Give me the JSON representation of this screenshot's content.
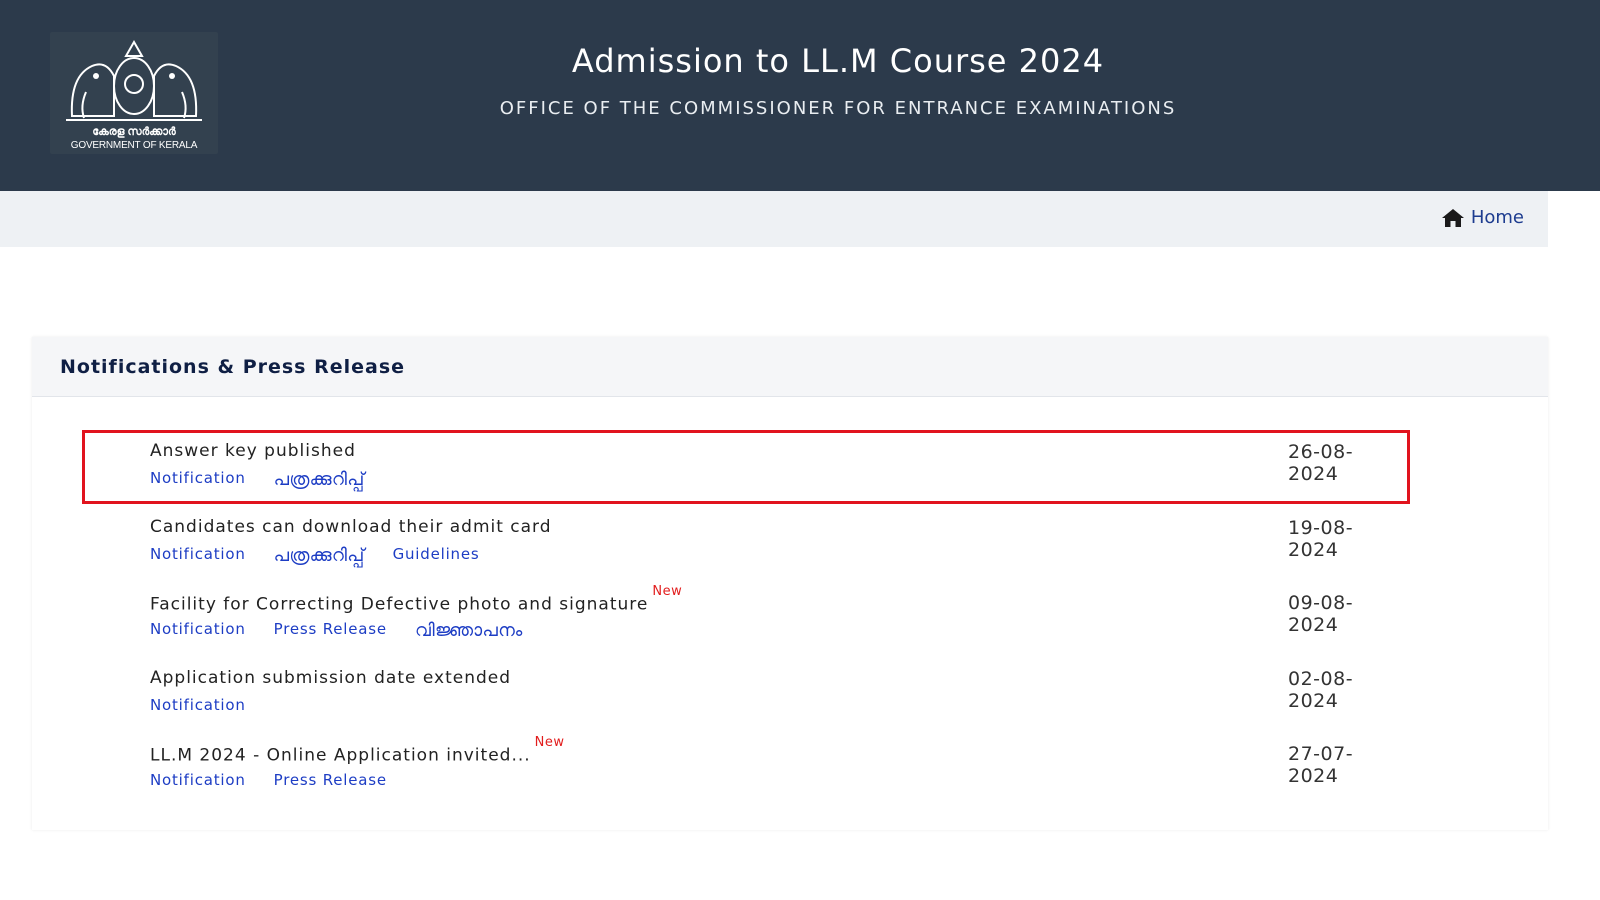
{
  "header": {
    "title": "Admission to LL.M Course 2024",
    "subtitle": "OFFICE OF THE COMMISSIONER FOR ENTRANCE EXAMINATIONS",
    "logo_text_ml": "കേരള സർക്കാർ",
    "logo_text_en": "GOVERNMENT OF KERALA"
  },
  "nav": {
    "home_label": "Home",
    "home_icon": "home-icon"
  },
  "panel": {
    "title": "Notifications & Press Release",
    "items": [
      {
        "title": "Answer key published",
        "new_badge": "",
        "date": "26-08-2024",
        "links": [
          "Notification",
          "പത്രക്കുറിപ്പ്"
        ]
      },
      {
        "title": "Candidates can download their admit card",
        "new_badge": "",
        "date": "19-08-2024",
        "links": [
          "Notification",
          "പത്രക്കുറിപ്പ്",
          "Guidelines"
        ]
      },
      {
        "title": "Facility for Correcting Defective photo and signature",
        "new_badge": "New",
        "date": "09-08-2024",
        "links": [
          "Notification",
          "Press Release",
          "വിജ്ഞാപനം"
        ]
      },
      {
        "title": "Application submission date extended",
        "new_badge": "",
        "date": "02-08-2024",
        "links": [
          "Notification"
        ]
      },
      {
        "title": "LL.M 2024 - Online Application invited...",
        "new_badge": "New",
        "date": "27-07-2024",
        "links": [
          "Notification",
          "Press Release"
        ]
      }
    ]
  },
  "colors": {
    "header_bg": "#2c3a4b",
    "link": "#1d3dc4",
    "new_badge": "#e21d1d",
    "highlight_border": "#e1131e"
  }
}
